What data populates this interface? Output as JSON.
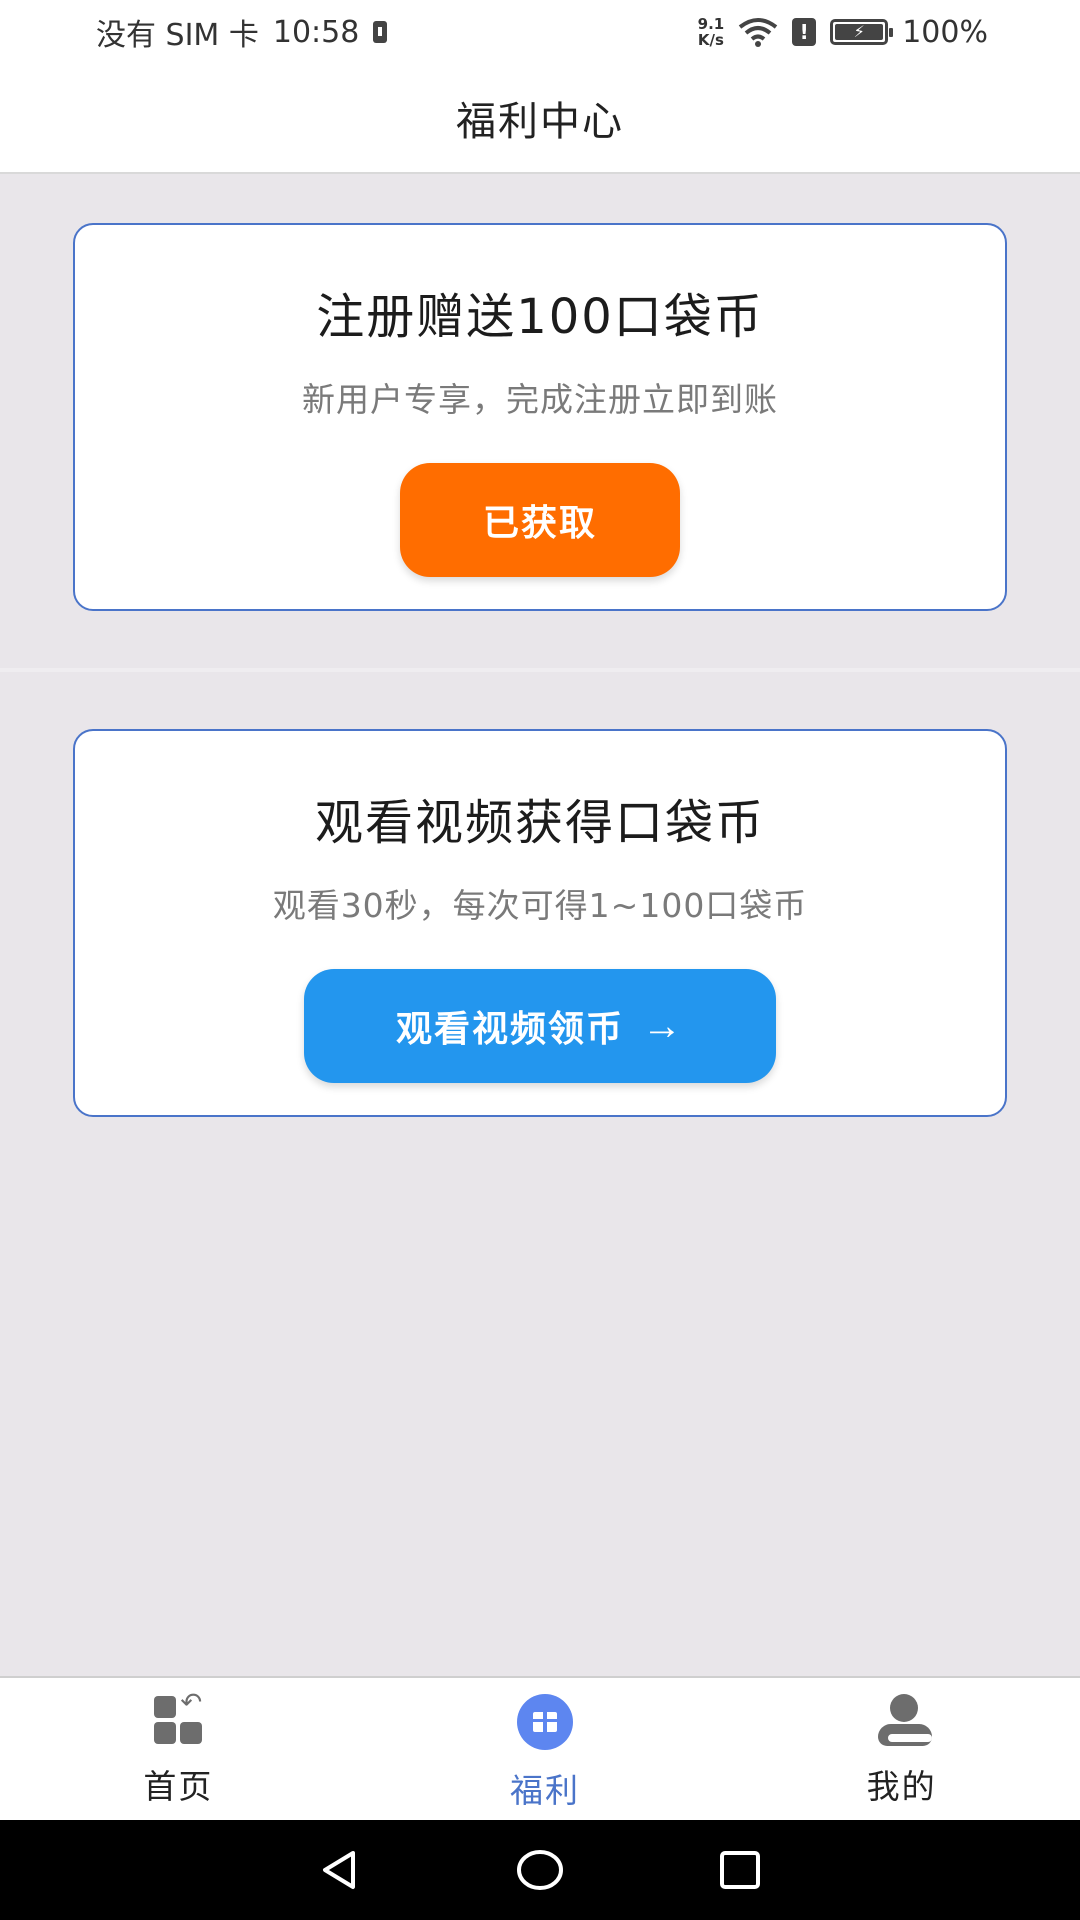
{
  "status_bar": {
    "carrier": "没有 SIM 卡",
    "time": "10:58",
    "net_speed_value": "9.1",
    "net_speed_unit": "K/s",
    "battery": "100%"
  },
  "header": {
    "title": "福利中心"
  },
  "cards": [
    {
      "title": "注册赠送100口袋币",
      "subtitle": "新用户专享，完成注册立即到账",
      "button_label": "已获取",
      "button_color": "#ff6d00"
    },
    {
      "title": "观看视频获得口袋币",
      "subtitle": "观看30秒，每次可得1~100口袋币",
      "button_label": "观看视频领币",
      "button_arrow": "→",
      "button_color": "#2396ee"
    }
  ],
  "bottom_nav": {
    "items": [
      {
        "label": "首页",
        "icon": "home-grid-icon",
        "active": false
      },
      {
        "label": "福利",
        "icon": "gift-icon",
        "active": true
      },
      {
        "label": "我的",
        "icon": "user-icon",
        "active": false
      }
    ],
    "active_color": "#4a74c9"
  },
  "system_nav": {
    "buttons": [
      "back-icon",
      "home-icon",
      "recents-icon"
    ]
  }
}
